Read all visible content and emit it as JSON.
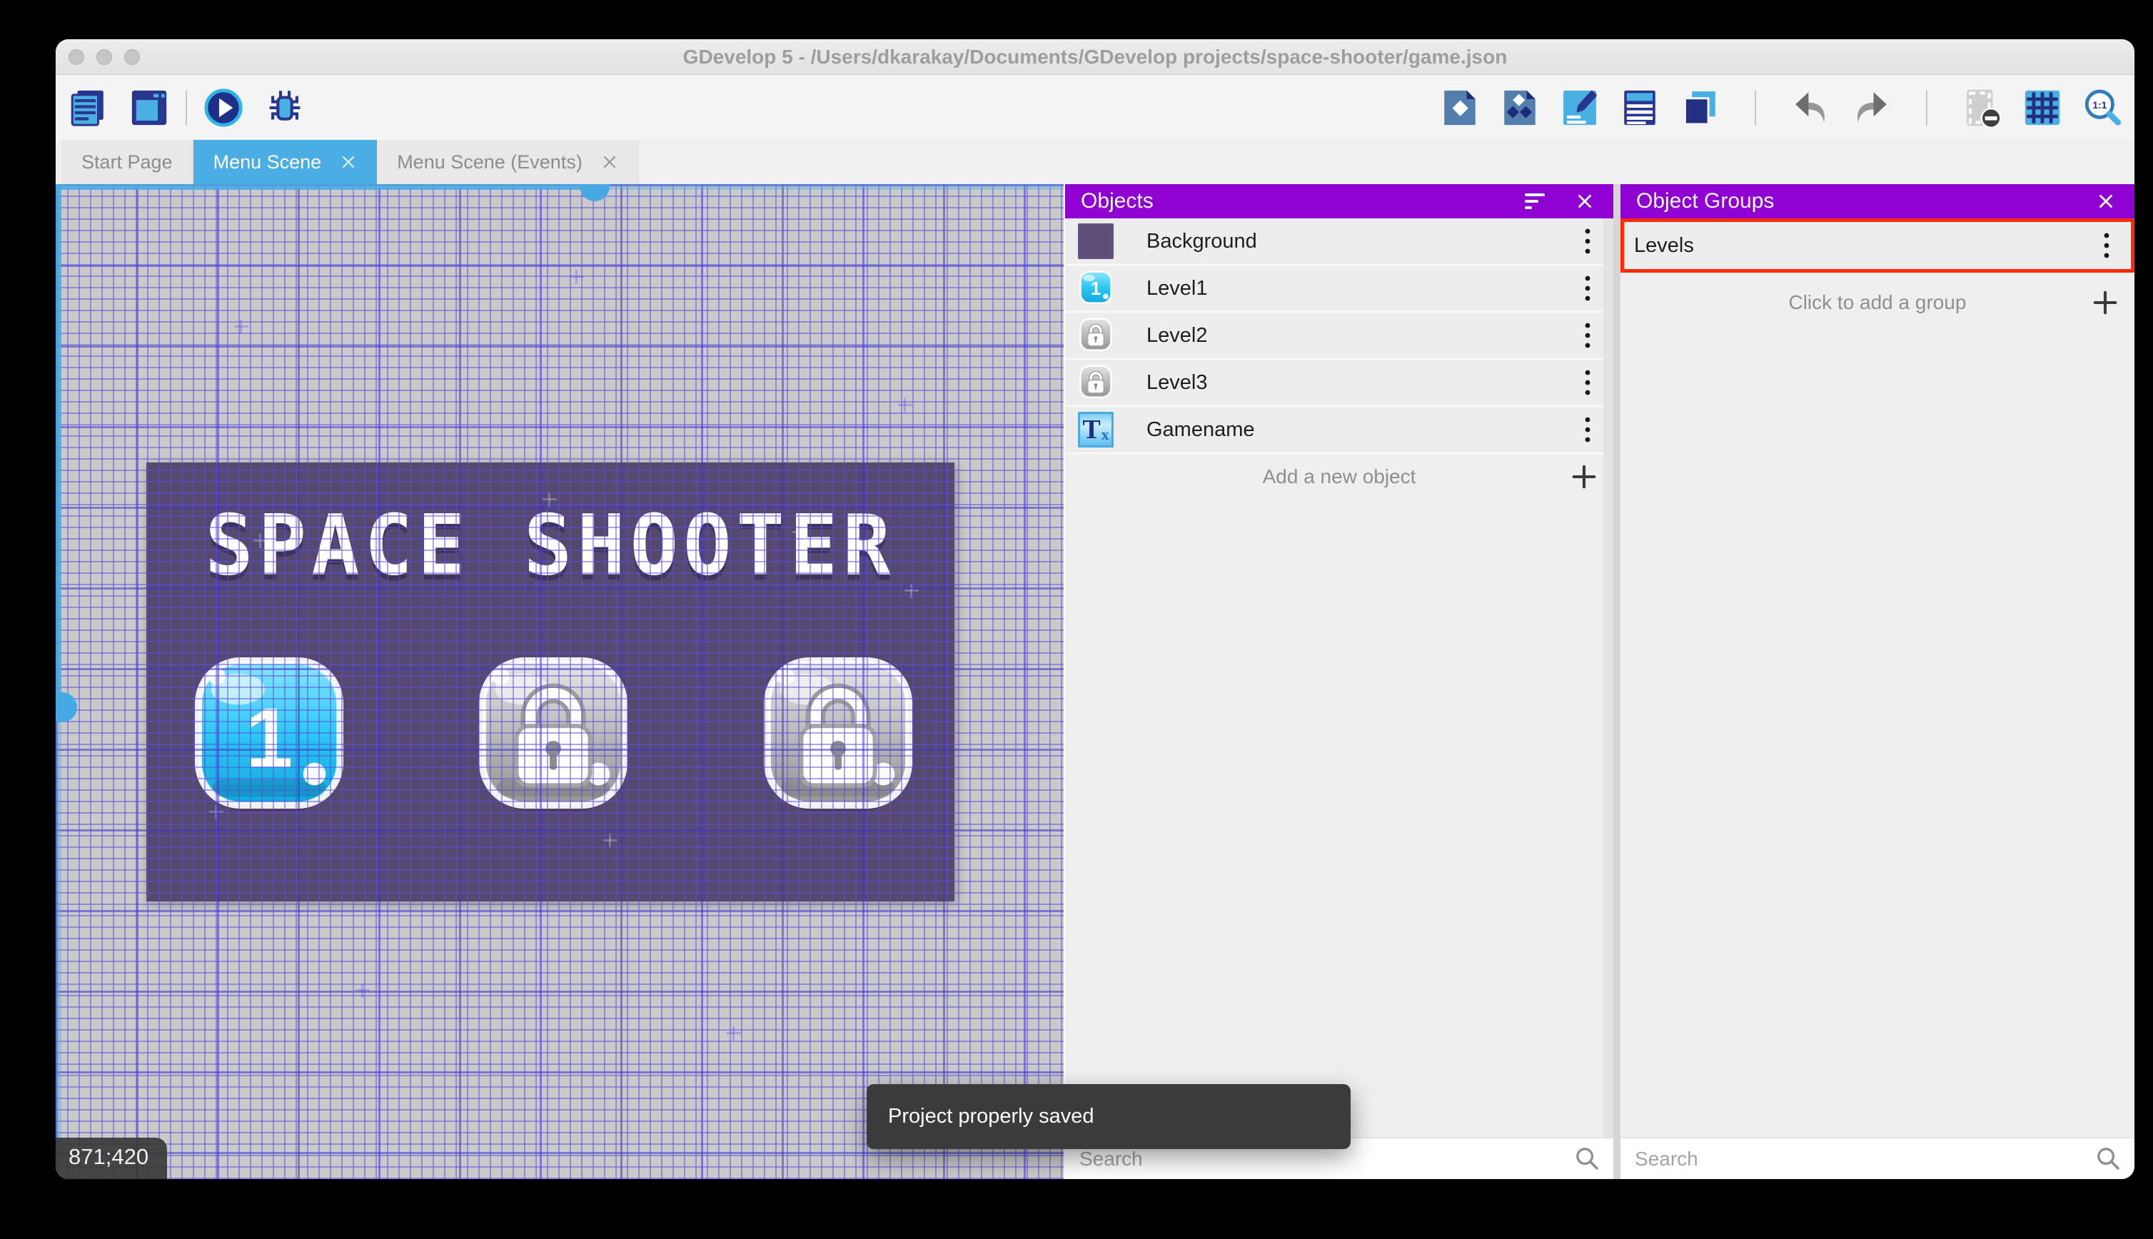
{
  "window": {
    "title": "GDevelop 5 - /Users/dkarakay/Documents/GDevelop projects/space-shooter/game.json"
  },
  "toolbar": {
    "left_icons": [
      "project-manager",
      "scene-editor",
      "play",
      "debug"
    ],
    "right_icons": [
      "objects-panel",
      "object-groups",
      "scene-properties",
      "instances-list",
      "layers",
      "undo",
      "redo",
      "window-mask",
      "grid",
      "zoom-reset"
    ],
    "zoom_label": "1:1"
  },
  "tabs": [
    {
      "label": "Start Page",
      "active": false,
      "closable": false
    },
    {
      "label": "Menu Scene",
      "active": true,
      "closable": true
    },
    {
      "label": "Menu Scene (Events)",
      "active": false,
      "closable": true
    }
  ],
  "scene": {
    "title": "SPACE SHOOTER",
    "coordinates": "871;420",
    "buttons": [
      {
        "label": "1",
        "state": "unlocked"
      },
      {
        "label": "",
        "state": "locked"
      },
      {
        "label": "",
        "state": "locked"
      }
    ]
  },
  "objects_panel": {
    "title": "Objects",
    "items": [
      {
        "label": "Background",
        "thumb": "purple-square"
      },
      {
        "label": "Level1",
        "thumb": "blue-button",
        "thumb_label": "1"
      },
      {
        "label": "Level2",
        "thumb": "locked-button"
      },
      {
        "label": "Level3",
        "thumb": "locked-button"
      },
      {
        "label": "Gamename",
        "thumb": "text-object",
        "thumb_t": "T",
        "thumb_x": "x"
      }
    ],
    "add_label": "Add a new object",
    "search_placeholder": "Search"
  },
  "groups_panel": {
    "title": "Object Groups",
    "items": [
      {
        "label": "Levels",
        "highlighted": true
      }
    ],
    "add_label": "Click to add a group",
    "search_placeholder": "Search"
  },
  "toast": {
    "message": "Project properly saved"
  },
  "colors": {
    "panel_header": "#8f00d2",
    "active_tab": "#4aaee4",
    "highlight_red": "#ff2a0a",
    "scene_background": "#57486e",
    "grid_line": "#584ee0",
    "toast_background": "#3b3b3b"
  }
}
